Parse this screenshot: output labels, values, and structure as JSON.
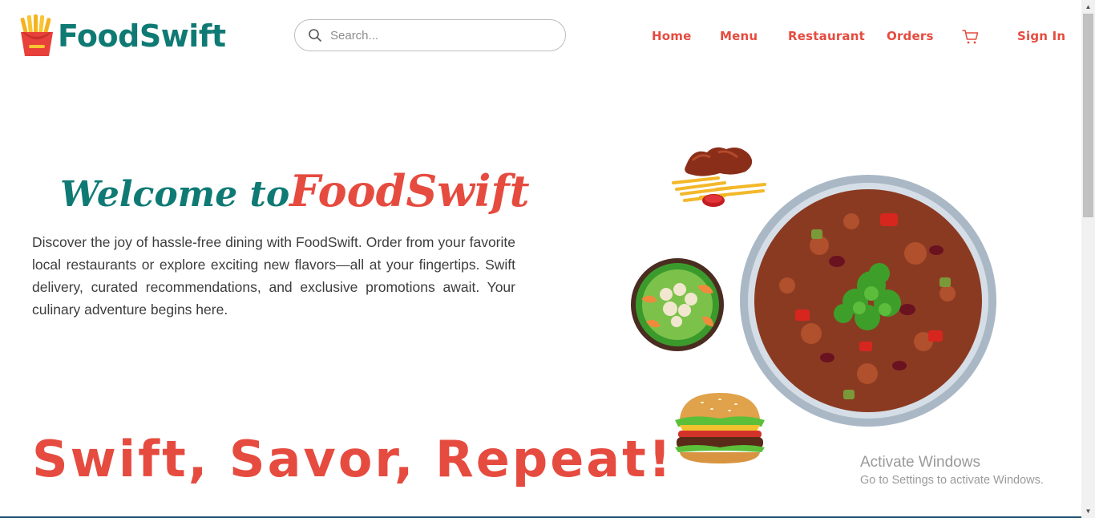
{
  "brand": {
    "name": "FoodSwift",
    "color": "#0f7a74",
    "accent": "#e64b3f",
    "icon": "fries-icon"
  },
  "search": {
    "placeholder": "Search...",
    "value": "",
    "icon": "search-icon"
  },
  "nav": {
    "home": "Home",
    "menu": "Menu",
    "restaurant": "Restaurant",
    "orders": "Orders",
    "cart_icon": "cart-icon",
    "signin": "Sign In"
  },
  "hero": {
    "welcome_prefix": "Welcome to",
    "welcome_brand": "FoodSwift",
    "intro": "Discover the joy of hassle-free dining with FoodSwift. Order from your favorite local restaurants or explore exciting new flavors—all at your fingertips. Swift delivery, curated recommendations, and exclusive promotions await. Your culinary adventure begins here.",
    "tagline": "Swift, Savor, Repeat!"
  },
  "images": {
    "wings": "wings-and-fries-image",
    "salad": "shrimp-salad-image",
    "burger": "burger-image",
    "bowl": "rice-bowl-image"
  },
  "watermark": {
    "title": "Activate Windows",
    "subtitle": "Go to Settings to activate Windows."
  }
}
